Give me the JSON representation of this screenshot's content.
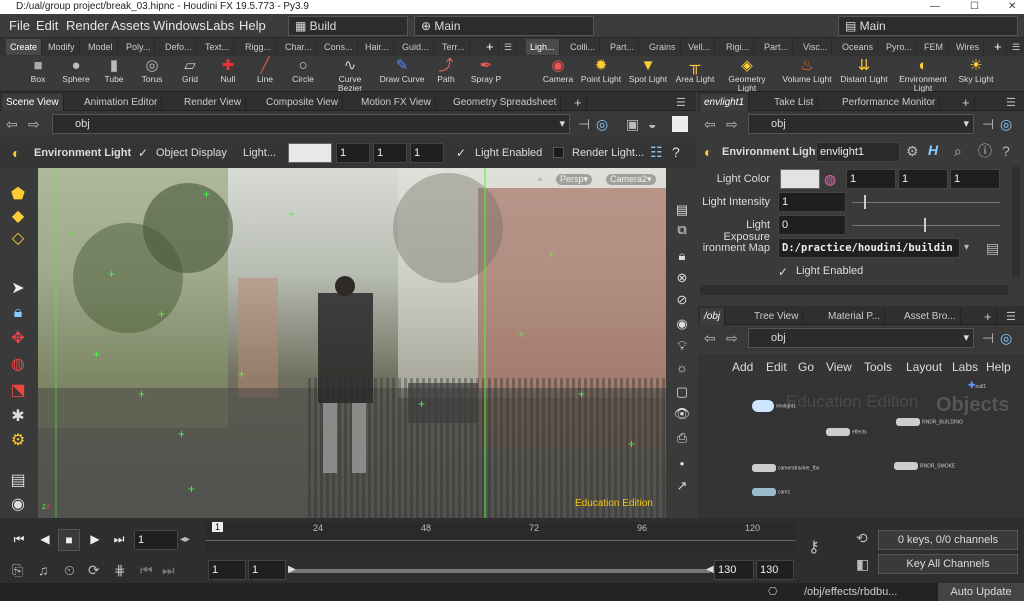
{
  "window": {
    "title": "D:/ual/group project/break_03.hipnc - Houdini FX 19.5.773 - Py3.9"
  },
  "menubar": {
    "items": [
      "File",
      "Edit",
      "Render",
      "Assets",
      "Windows",
      "Labs",
      "Help"
    ],
    "desktop_left": "Build",
    "desktop_mid": "Main",
    "desktop_right": "Main"
  },
  "shelf_tabs_left": [
    "Create",
    "Modify",
    "Model",
    "Poly...",
    "Defo...",
    "Text...",
    "Rigg...",
    "Char...",
    "Cons...",
    "Hair...",
    "Guid...",
    "Terr..."
  ],
  "shelf_tabs_right": [
    "Ligh...",
    "Colli...",
    "Part...",
    "Grains",
    "Vell...",
    "Rigi...",
    "Part...",
    "Visc...",
    "Oceans",
    "Pyro...",
    "FEM",
    "Wires"
  ],
  "tools_left": [
    {
      "label": "Box",
      "icon": "box-icon"
    },
    {
      "label": "Sphere",
      "icon": "sphere-icon"
    },
    {
      "label": "Tube",
      "icon": "tube-icon"
    },
    {
      "label": "Torus",
      "icon": "torus-icon"
    },
    {
      "label": "Grid",
      "icon": "grid-icon"
    },
    {
      "label": "Null",
      "icon": "null-icon"
    },
    {
      "label": "Line",
      "icon": "line-icon"
    },
    {
      "label": "Circle",
      "icon": "circle-icon"
    },
    {
      "label": "Curve Bezier",
      "icon": "curve-bezier-icon"
    },
    {
      "label": "Draw Curve",
      "icon": "draw-curve-icon"
    },
    {
      "label": "Path",
      "icon": "path-icon"
    },
    {
      "label": "Spray P",
      "icon": "spray-paint-icon"
    }
  ],
  "tools_right": [
    {
      "label": "Camera",
      "icon": "camera-icon"
    },
    {
      "label": "Point Light",
      "icon": "point-light-icon"
    },
    {
      "label": "Spot Light",
      "icon": "spot-light-icon"
    },
    {
      "label": "Area Light",
      "icon": "area-light-icon"
    },
    {
      "label": "Geometry Light",
      "icon": "geometry-light-icon"
    },
    {
      "label": "Volume Light",
      "icon": "volume-light-icon"
    },
    {
      "label": "Distant Light",
      "icon": "distant-light-icon"
    },
    {
      "label": "Environment Light",
      "icon": "environment-light-icon"
    },
    {
      "label": "Sky Light",
      "icon": "sky-light-icon"
    }
  ],
  "left_tabs": [
    "Scene View",
    "Animation Editor",
    "Render View",
    "Composite View",
    "Motion FX View",
    "Geometry Spreadsheet"
  ],
  "left_path": "obj",
  "viewer_bar": {
    "node_name": "Environment Light",
    "object_display": "Object Display",
    "light_label": "Light...",
    "v1": "1",
    "v2": "1",
    "v3": "1",
    "light_enabled": "Light Enabled",
    "render_light": "Render Light..."
  },
  "viewport": {
    "persp": "Persp",
    "camera": "Camera2",
    "watermark": "Education Edition"
  },
  "right_top_tabs": [
    "envlight1",
    "Take List",
    "Performance Monitor"
  ],
  "right_top_path": "obj",
  "params": {
    "node_type": "Environment Light",
    "node_name": "envlight1",
    "light_color_label": "Light Color",
    "light_color": [
      "1",
      "1",
      "1"
    ],
    "intensity_label": "Light Intensity",
    "intensity": "1",
    "exposure_label": "Light Exposure",
    "exposure": "0",
    "envmap_label": "ironment Map",
    "envmap": "D:/practice/houdini/buildin",
    "enabled_label": "Light Enabled"
  },
  "right_bottom_tabs": [
    "/obj",
    "Tree View",
    "Material P...",
    "Asset Bro..."
  ],
  "right_bottom_path": "obj",
  "net_menu": [
    "Add",
    "Edit",
    "Go",
    "View",
    "Tools",
    "Layout",
    "Labs",
    "Help"
  ],
  "network": {
    "edition": "Education Edition",
    "context": "Objects",
    "nodes": [
      {
        "name": "null1"
      },
      {
        "name": "envlight1"
      },
      {
        "name": "effects"
      },
      {
        "name": "RNDR_BUILDING"
      },
      {
        "name": "cameratracker_fbx"
      },
      {
        "name": "RNDR_SMOKE"
      },
      {
        "name": "cam1"
      }
    ]
  },
  "timeline": {
    "frame": "1",
    "ticks": [
      "1",
      "24",
      "48",
      "72",
      "96",
      "120"
    ],
    "start": "1",
    "start2": "1",
    "end": "130",
    "end2": "130",
    "keys": "0 keys, 0/0 channels",
    "key_all": "Key All Channels"
  },
  "status": {
    "path": "/obj/effects/rbdbu...",
    "update": "Auto Update"
  }
}
